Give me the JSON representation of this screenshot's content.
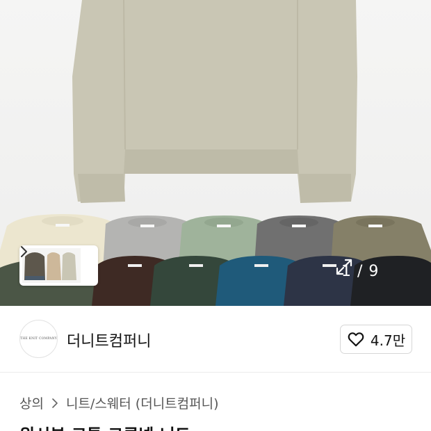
{
  "gallery": {
    "counter": "1 / 9",
    "thumbnail_label": "color options thumbnail",
    "icons": {
      "next": "chevron-right-icon",
      "expand": "expand-icon"
    }
  },
  "brand": {
    "logo_text": "THE KNIT COMPANY",
    "name": "더니트컴퍼니",
    "like_count": "4.7만",
    "icons": {
      "like": "heart-outline-icon"
    }
  },
  "breadcrumb": {
    "items": [
      "상의",
      "니트/스웨터 (더니트컴퍼니)"
    ],
    "separator_icon": "chevron-right-icon"
  },
  "product": {
    "title_partial": "위시본 코튼 크루넥 니트"
  },
  "colors": {
    "hero_sweater": "#c9c6b4",
    "row1": [
      "#ece6cf",
      "#b4b4b2",
      "#9fb39b",
      "#707070",
      "#858068"
    ],
    "row2": [
      "#4b5646",
      "#3e2a24",
      "#34473b",
      "#1f5a7a",
      "#2d3446",
      "#1f2124"
    ]
  }
}
